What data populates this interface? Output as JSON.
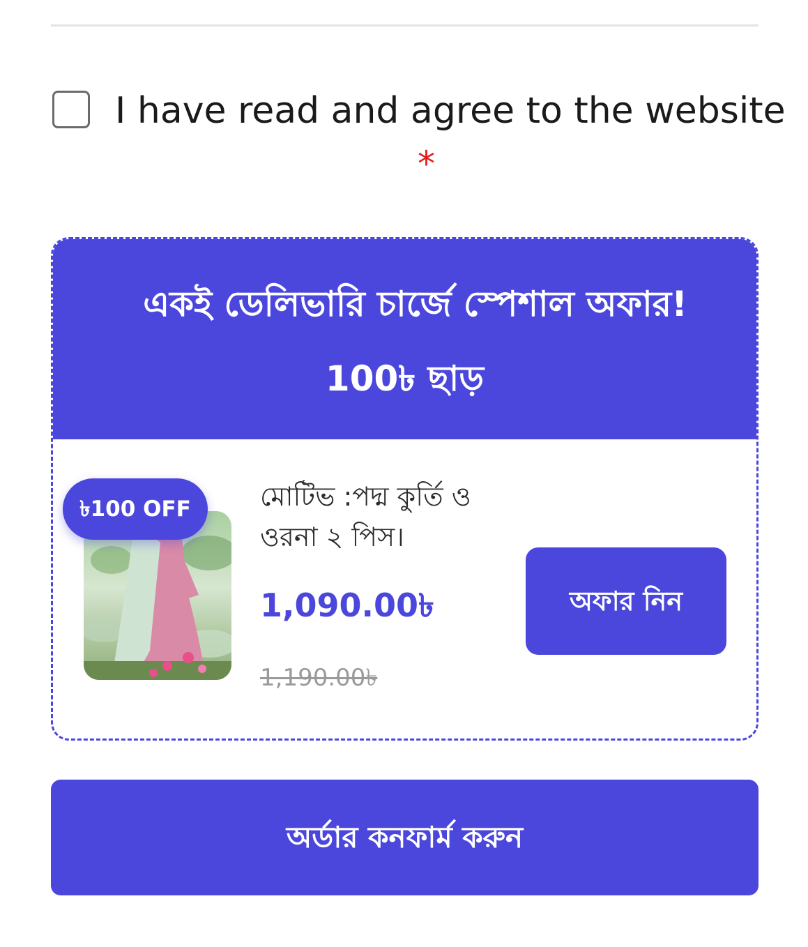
{
  "agreement": {
    "checked": false,
    "label": "I have read and agree to the website",
    "required_mark": "*"
  },
  "offer": {
    "title": "একই ডেলিভারি চার্জে স্পেশাল অফার!",
    "subtitle": "100৳ ছাড়",
    "product": {
      "badge": "৳100 OFF",
      "image_icon": "product-photo-pink-kurti",
      "name": "মোটিভ :পদ্ম কুর্তি ও ওরনা ২ পিস।",
      "price": "1,090.00৳",
      "old_price": "1,190.00৳"
    },
    "button_label": "অফার নিন"
  },
  "confirm_button_label": "অর্ডার কনফার্ম করুন",
  "colors": {
    "accent": "#4b47dc",
    "required": "#e51b1b",
    "old_price": "#9a9a9a"
  }
}
